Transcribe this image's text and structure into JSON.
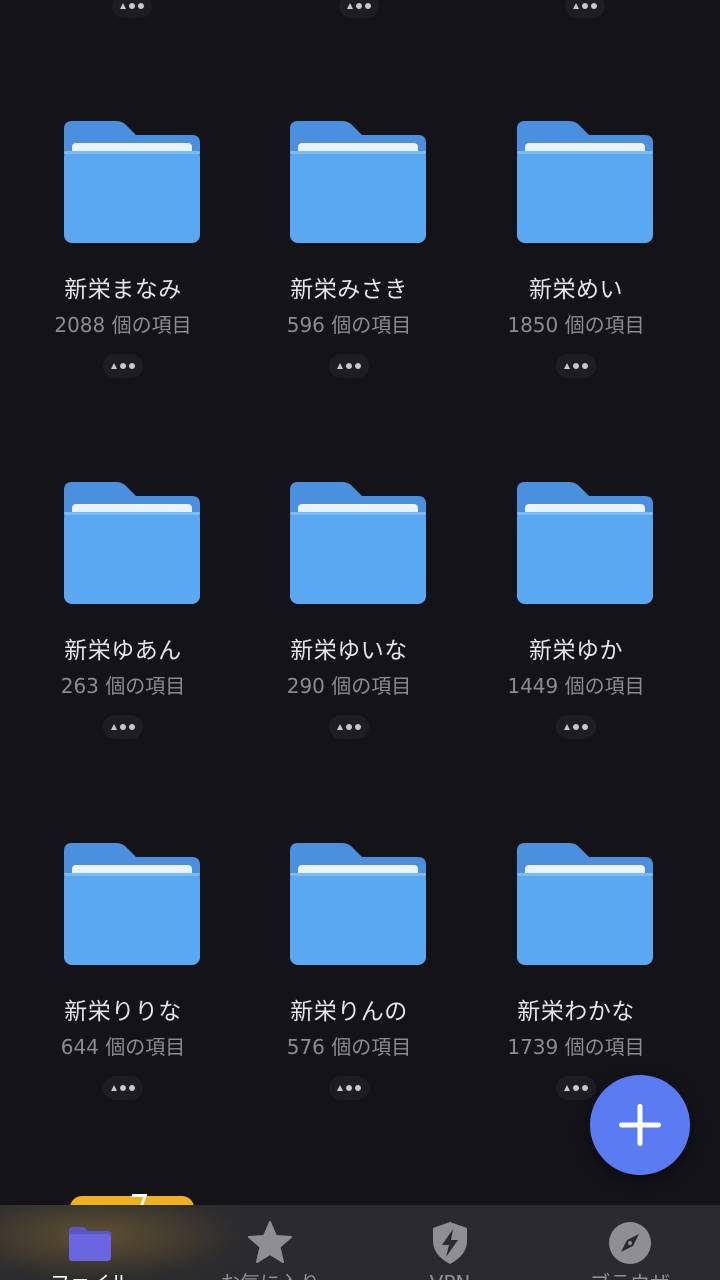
{
  "folders": [
    {
      "name": "新栄まなみ",
      "count": "2088 個の項目"
    },
    {
      "name": "新栄みさき",
      "count": "596 個の項目"
    },
    {
      "name": "新栄めい",
      "count": "1850 個の項目"
    },
    {
      "name": "新栄ゆあん",
      "count": "263 個の項目"
    },
    {
      "name": "新栄ゆいな",
      "count": "290 個の項目"
    },
    {
      "name": "新栄ゆか",
      "count": "1449 個の項目"
    },
    {
      "name": "新栄りりな",
      "count": "644 個の項目"
    },
    {
      "name": "新栄りんの",
      "count": "576 個の項目"
    },
    {
      "name": "新栄わかな",
      "count": "1739 個の項目"
    }
  ],
  "tabs": [
    {
      "label": "ファイル",
      "icon": "folder-icon",
      "active": true
    },
    {
      "label": "お気に入り",
      "icon": "star-icon",
      "active": false
    },
    {
      "label": "VPN",
      "icon": "shield-bolt-icon",
      "active": false
    },
    {
      "label": "ブラウザ",
      "icon": "compass-icon",
      "active": false
    }
  ],
  "colors": {
    "background": "#141318",
    "folder_blue": "#5aa8f2",
    "fab": "#5a7bf2",
    "tabbar": "#2a2a2f"
  },
  "fab": {
    "icon": "plus-icon"
  }
}
